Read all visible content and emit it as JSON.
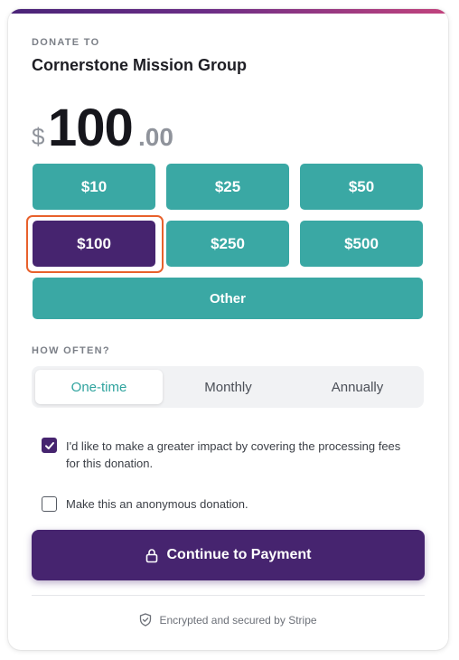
{
  "header": {
    "donate_to_label": "DONATE TO",
    "org_name": "Cornerstone Mission Group"
  },
  "amount": {
    "currency_symbol": "$",
    "whole": "100",
    "cents": ".00"
  },
  "preset_amounts": [
    {
      "label": "$10",
      "selected": false
    },
    {
      "label": "$25",
      "selected": false
    },
    {
      "label": "$50",
      "selected": false
    },
    {
      "label": "$100",
      "selected": true
    },
    {
      "label": "$250",
      "selected": false
    },
    {
      "label": "$500",
      "selected": false
    }
  ],
  "other_label": "Other",
  "frequency": {
    "label": "HOW OFTEN?",
    "options": [
      "One-time",
      "Monthly",
      "Annually"
    ],
    "selected": "One-time"
  },
  "options": {
    "cover_fees_text": "I'd like to make a greater impact by covering the processing fees for this donation.",
    "cover_fees_checked": true,
    "anonymous_text": "Make this an anonymous donation.",
    "anonymous_checked": false
  },
  "submit": {
    "label": "Continue to Payment",
    "icon": "lock-icon"
  },
  "footer": {
    "secure_text": "Encrypted and secured by Stripe",
    "icon": "shield-check-icon"
  },
  "colors": {
    "brand_purple": "#46246f",
    "teal": "#3aa8a4",
    "selection_ring": "#e8612c"
  }
}
